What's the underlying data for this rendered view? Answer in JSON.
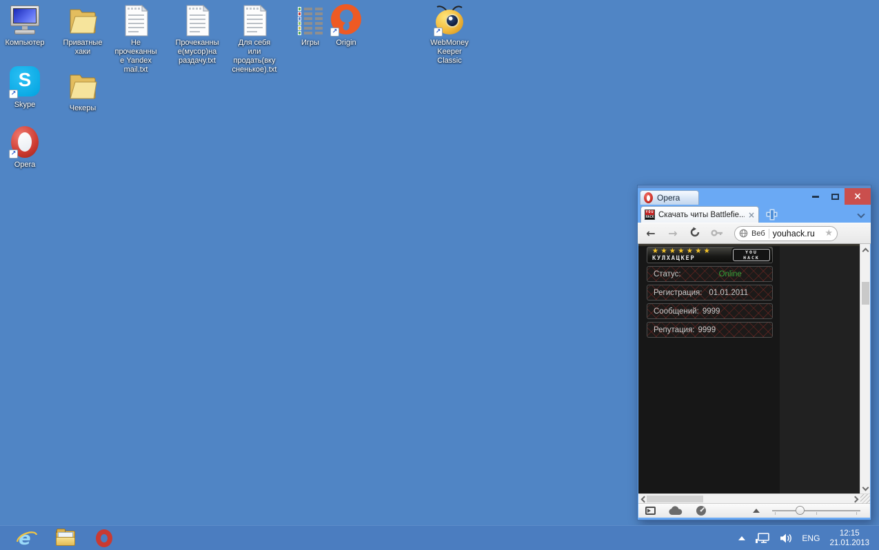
{
  "desktop": {
    "icons": [
      {
        "name": "computer",
        "label": "Компьютер"
      },
      {
        "name": "private-hacks-folder",
        "label": "Приватные\nхаки"
      },
      {
        "name": "unchecked-yandex-txt",
        "label": "Не\nпрочеканны\nе Yandex\nmail.txt"
      },
      {
        "name": "checked-trash-txt",
        "label": "Прочеканны\nе(мусор)на\nраздачу.txt"
      },
      {
        "name": "for-self-or-sell-txt",
        "label": "Для себя\nили\nпродать(вку\nсненькое).txt"
      },
      {
        "name": "games",
        "label": "Игры"
      },
      {
        "name": "origin",
        "label": "Origin"
      },
      {
        "name": "webmoney",
        "label": "WebMoney\nKeeper\nClassic"
      },
      {
        "name": "skype",
        "label": "Skype"
      },
      {
        "name": "checkers-folder",
        "label": "Чекеры"
      },
      {
        "name": "opera",
        "label": "Opera"
      }
    ]
  },
  "window": {
    "menu_button": "Opera",
    "controls": {
      "close": "×"
    },
    "tab": {
      "title": "Скачать читы Battlefie...",
      "close_glyph": "×",
      "favicon_line1": "YOU",
      "favicon_line2": "HACK"
    },
    "toolbar": {
      "back_glyph": "←",
      "forward_glyph": "→",
      "search_engine_label": "Веб",
      "url": "youhack.ru",
      "bookmark_star_glyph": "★"
    },
    "page": {
      "stars": "★★★★★★★",
      "brand": "КУЛХАЦКЕР",
      "badge_line1": "YOU",
      "badge_line2": "HACK",
      "rows": [
        {
          "label": "Статус:",
          "value": "Online"
        },
        {
          "label": "Регистрация:",
          "value": "01.01.2011"
        },
        {
          "label": "Сообщений:",
          "value": "9999"
        },
        {
          "label": "Репутация:",
          "value": "9999"
        }
      ]
    }
  },
  "taskbar": {
    "language": "ENG",
    "time": "12:15",
    "date": "21.01.2013"
  },
  "glyphs": {
    "shortcut_arrow": "↗",
    "skype_letter": "S"
  },
  "colors": {
    "desktop_bg": "#5085c5",
    "taskbar_bg": "#4b7dc0",
    "window_frame": "#6aa9f4",
    "close_button": "#ca4f4d",
    "online_green": "#3aa23a",
    "star_gold": "#f6c62d"
  }
}
